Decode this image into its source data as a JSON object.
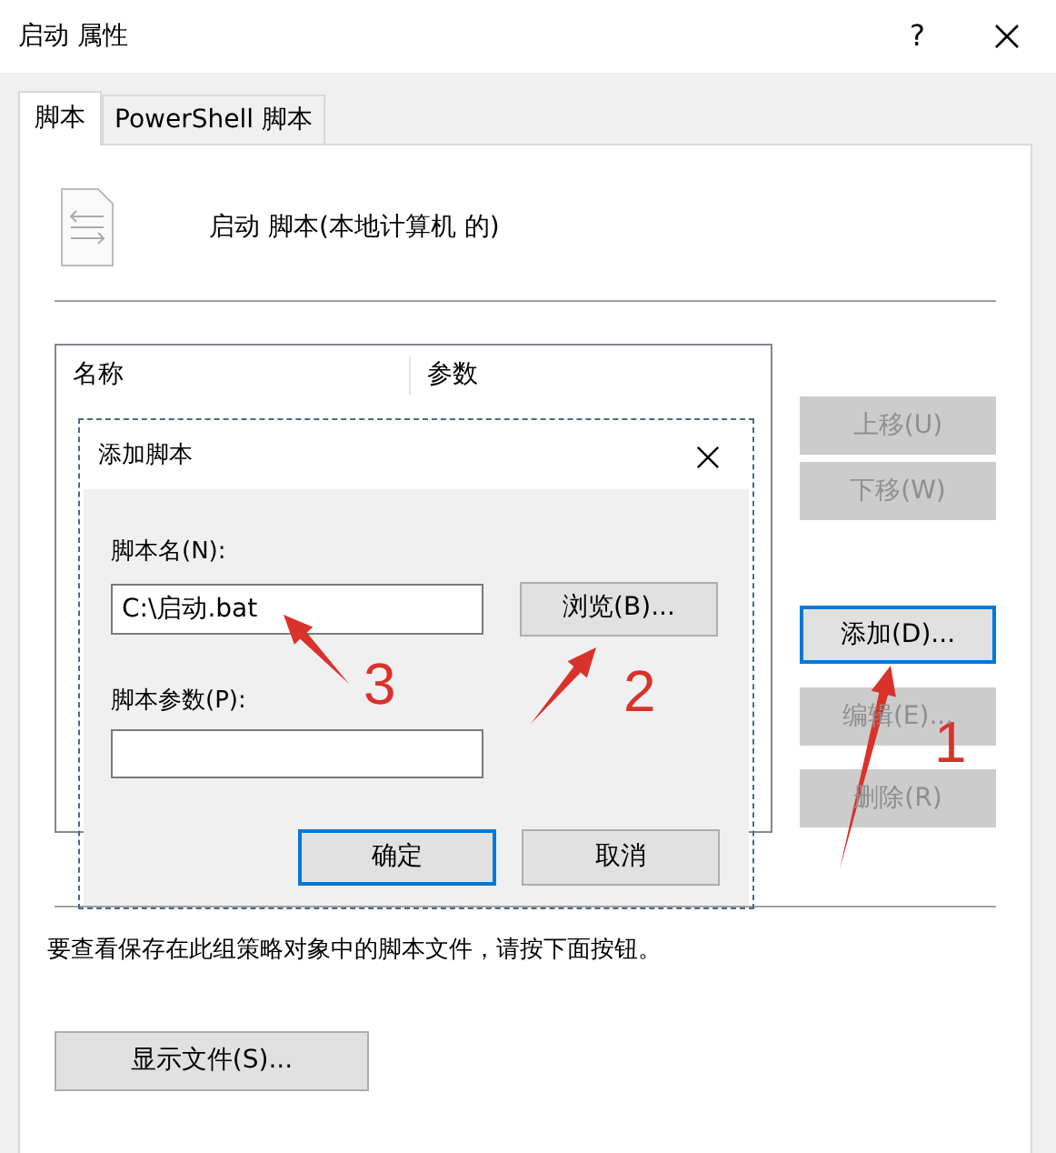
{
  "window": {
    "title": "启动 属性",
    "help": "?"
  },
  "tabs": [
    {
      "label": "脚本",
      "selected": true
    },
    {
      "label": "PowerShell 脚本",
      "selected": false
    }
  ],
  "header": {
    "text": "启动 脚本(本地计算机 的)"
  },
  "list": {
    "columns": [
      "名称",
      "参数"
    ]
  },
  "side_buttons": [
    {
      "label": "上移(U)",
      "disabled": true,
      "focused": false
    },
    {
      "label": "下移(W)",
      "disabled": true,
      "focused": false
    },
    {
      "label": "添加(D)...",
      "disabled": false,
      "focused": true
    },
    {
      "label": "编辑(E)...",
      "disabled": true,
      "focused": false
    },
    {
      "label": "删除(R)",
      "disabled": true,
      "focused": false
    }
  ],
  "hint": "要查看保存在此组策略对象中的脚本文件，请按下面按钮。",
  "show_files_button": "显示文件(S)...",
  "add_dialog": {
    "title": "添加脚本",
    "name_label": "脚本名(N):",
    "name_value": "C:\\启动.bat",
    "browse_button": "浏览(B)...",
    "params_label": "脚本参数(P):",
    "buttons": [
      {
        "label": "确定",
        "focused": true
      },
      {
        "label": "取消",
        "focused": false
      }
    ]
  },
  "annotations": [
    {
      "label": "1"
    },
    {
      "label": "2"
    },
    {
      "label": "3"
    }
  ]
}
